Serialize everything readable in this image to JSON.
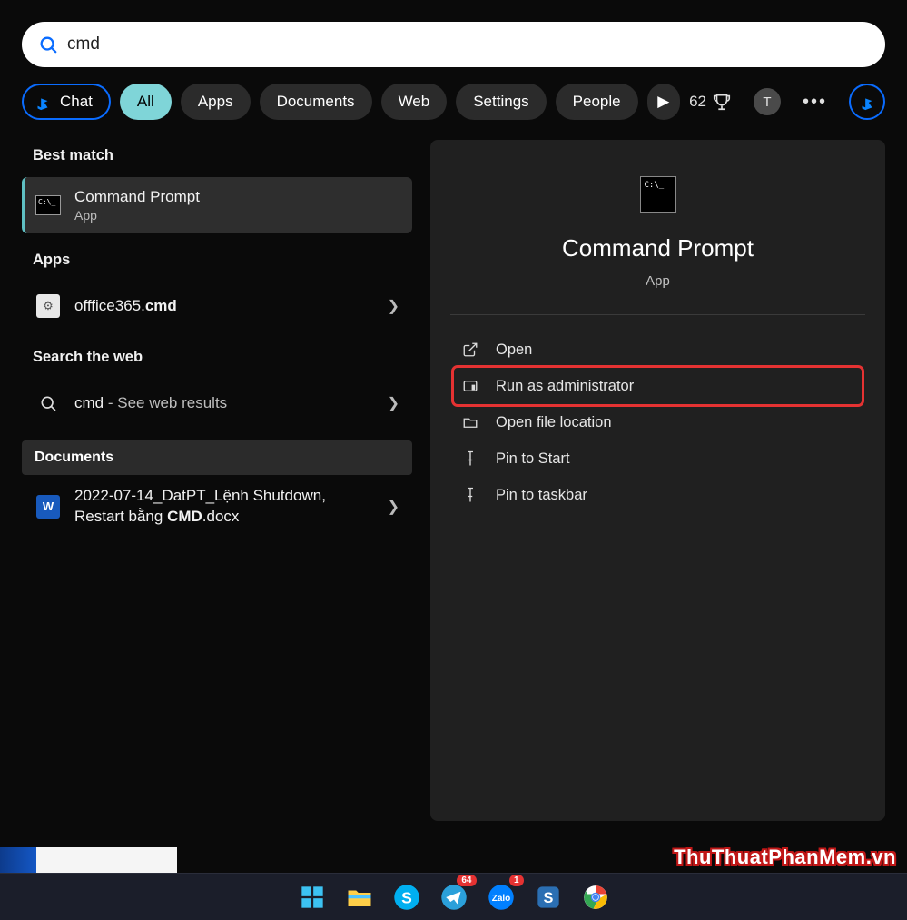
{
  "search": {
    "value": "cmd"
  },
  "tabs": {
    "chat": "Chat",
    "all": "All",
    "apps": "Apps",
    "documents": "Documents",
    "web": "Web",
    "settings": "Settings",
    "people": "People"
  },
  "rewards_count": "62",
  "avatar_letter": "T",
  "sections": {
    "best_match": "Best match",
    "apps": "Apps",
    "search_web": "Search the web",
    "documents": "Documents"
  },
  "best_match": {
    "title": "Command Prompt",
    "subtitle": "App"
  },
  "apps_item": {
    "prefix": "offfice365.",
    "bold": "cmd"
  },
  "web_item": {
    "prefix": "cmd",
    "suffix": " - See web results"
  },
  "doc_item": {
    "line1": "2022-07-14_DatPT_Lệnh Shutdown,",
    "line2_prefix": "Restart bằng ",
    "line2_bold": "CMD",
    "line2_suffix": ".docx"
  },
  "preview": {
    "title": "Command Prompt",
    "subtitle": "App"
  },
  "actions": {
    "open": "Open",
    "run_admin": "Run as administrator",
    "open_location": "Open file location",
    "pin_start": "Pin to Start",
    "pin_taskbar": "Pin to taskbar"
  },
  "watermark": "ThuThuatPhanMem.vn",
  "taskbar_badges": {
    "zalo_alt": "64",
    "notif": "1"
  },
  "cmd_prompt_glyph": "C:\\_"
}
